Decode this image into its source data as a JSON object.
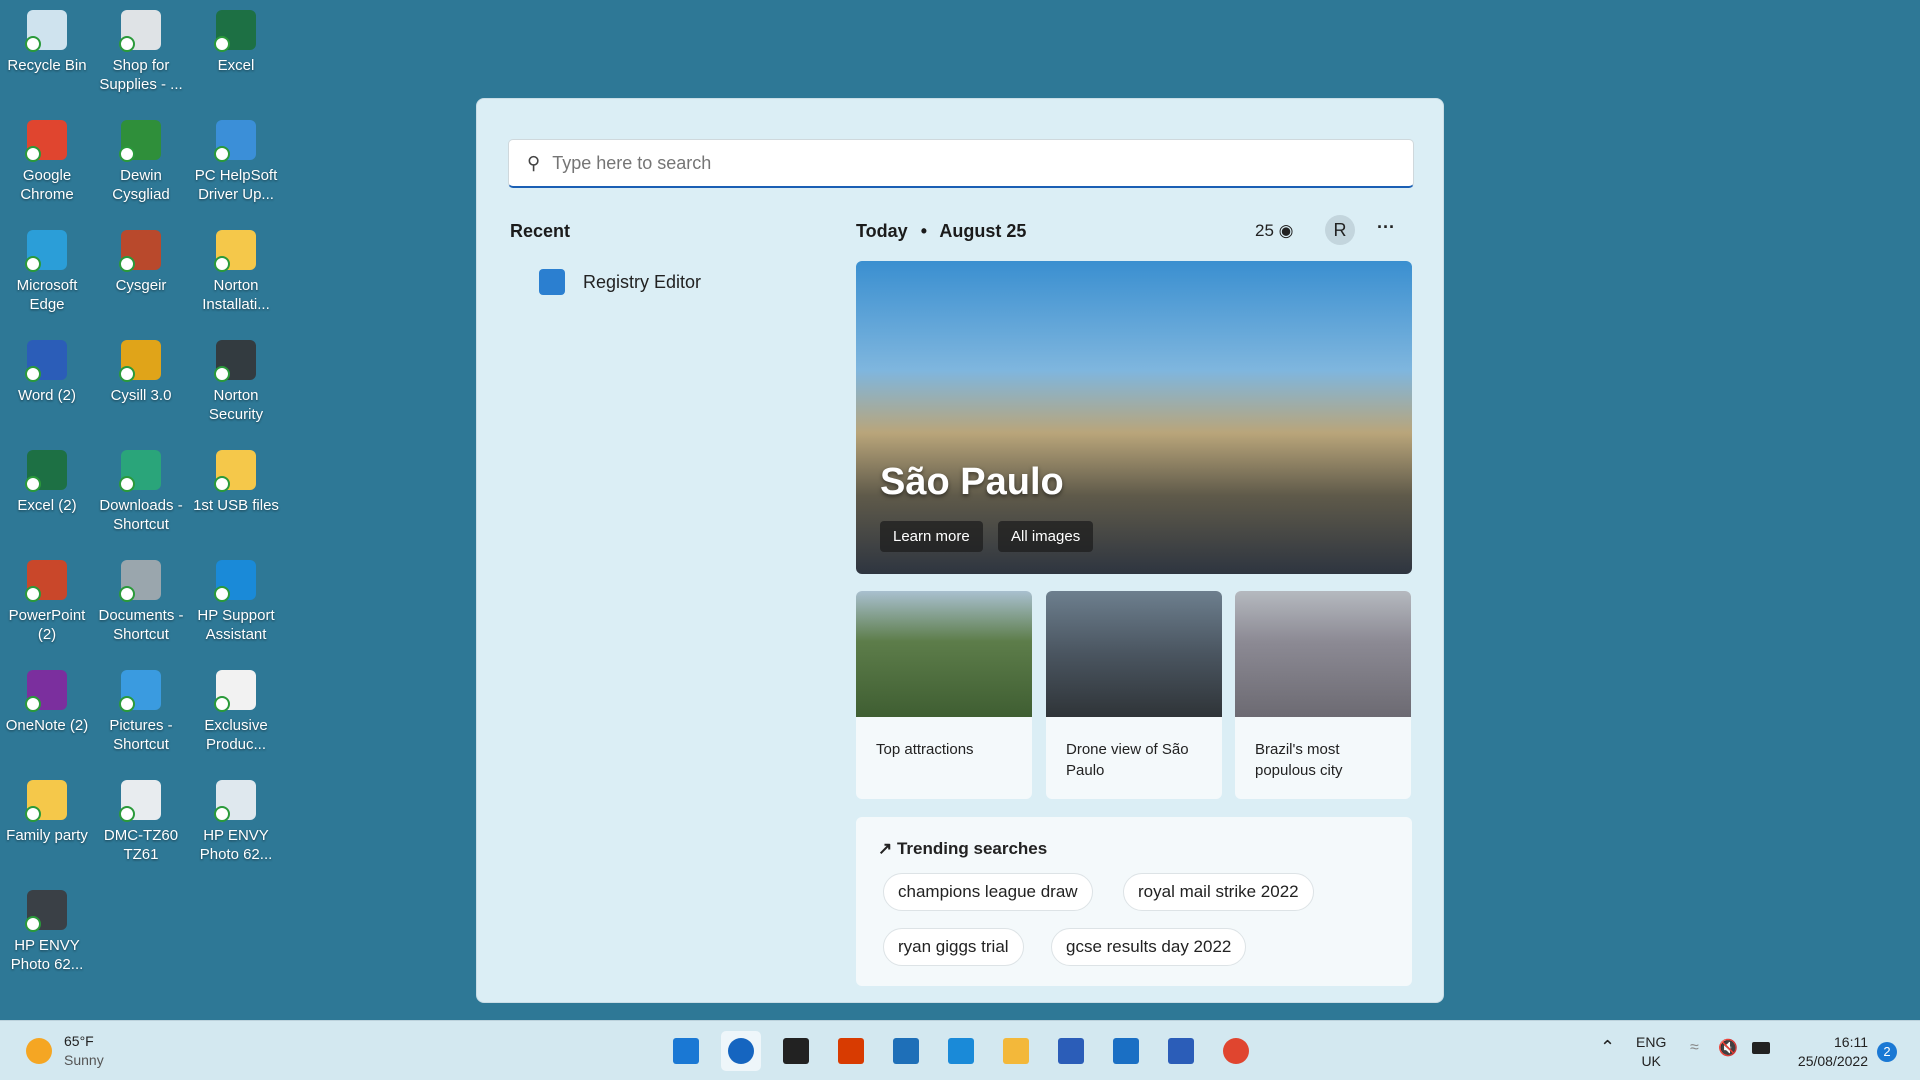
{
  "desktop": {
    "icons": [
      {
        "label": "Recycle Bin",
        "color": "#cfe3ee"
      },
      {
        "label": "Shop for Supplies - ...",
        "color": "#dfe3e6"
      },
      {
        "label": "Excel",
        "color": "#1d7044"
      },
      {
        "label": "Google Chrome",
        "color": "#e0452f"
      },
      {
        "label": "Dewin Cysgliad",
        "color": "#2f8f3a"
      },
      {
        "label": "PC HelpSoft Driver Up...",
        "color": "#3b8fd8"
      },
      {
        "label": "Microsoft Edge",
        "color": "#2b9ed8"
      },
      {
        "label": "Cysgeir",
        "color": "#b9492c"
      },
      {
        "label": "Norton Installati...",
        "color": "#f5c84a"
      },
      {
        "label": "Word (2)",
        "color": "#2b5db8"
      },
      {
        "label": "Cysill 3.0",
        "color": "#e0a419"
      },
      {
        "label": "Norton Security",
        "color": "#333b40"
      },
      {
        "label": "Excel (2)",
        "color": "#1d7044"
      },
      {
        "label": "Downloads - Shortcut",
        "color": "#2aa57a"
      },
      {
        "label": "1st USB files",
        "color": "#f5c84a"
      },
      {
        "label": "PowerPoint (2)",
        "color": "#c9472a"
      },
      {
        "label": "Documents - Shortcut",
        "color": "#9aa6ad"
      },
      {
        "label": "HP Support Assistant",
        "color": "#1a8ad8"
      },
      {
        "label": "OneNote (2)",
        "color": "#7b2f9e"
      },
      {
        "label": "Pictures - Shortcut",
        "color": "#3a9be0"
      },
      {
        "label": "Exclusive Produc...",
        "color": "#f2f2f2"
      },
      {
        "label": "Family party",
        "color": "#f5c84a"
      },
      {
        "label": "DMC-TZ60 TZ61",
        "color": "#e8ecef"
      },
      {
        "label": "HP ENVY Photo 62...",
        "color": "#dfe8ee"
      },
      {
        "label": "HP ENVY Photo 62...",
        "color": "#3a4046"
      }
    ]
  },
  "search": {
    "placeholder": "Type here to search"
  },
  "recent": {
    "title": "Recent",
    "items": [
      {
        "label": "Registry Editor"
      }
    ]
  },
  "today": {
    "label": "Today",
    "sep": "•",
    "date": "August 25",
    "points": "25",
    "avatar": "R",
    "more": "···"
  },
  "hero": {
    "title": "São Paulo",
    "learn_more": "Learn more",
    "all_images": "All images"
  },
  "tiles": [
    {
      "label": "Top attractions",
      "color": "#5d7d4a"
    },
    {
      "label": "Drone view of São Paulo",
      "color": "#4a5560"
    },
    {
      "label": "Brazil's most populous city",
      "color": "#8c8a94"
    }
  ],
  "trending": {
    "title": "Trending searches",
    "items": [
      "champions league draw",
      "royal mail strike 2022",
      "ryan giggs trial",
      "gcse results day 2022"
    ]
  },
  "taskbar": {
    "weather_temp": "65°F",
    "weather_desc": "Sunny",
    "lang1": "ENG",
    "lang2": "UK",
    "time": "16:11",
    "date": "25/08/2022",
    "notifications": "2",
    "apps": [
      {
        "name": "start",
        "color": "#1a78d4"
      },
      {
        "name": "search",
        "color": "#1565c0"
      },
      {
        "name": "task-view",
        "color": "#222"
      },
      {
        "name": "office",
        "color": "#d83b01"
      },
      {
        "name": "remote-desktop",
        "color": "#1e6fb8"
      },
      {
        "name": "l-app",
        "color": "#1a8ad8"
      },
      {
        "name": "file-explorer",
        "color": "#f3b83a"
      },
      {
        "name": "store",
        "color": "#2b5db8"
      },
      {
        "name": "mail",
        "color": "#1a6fc4"
      },
      {
        "name": "word",
        "color": "#2b5db8"
      },
      {
        "name": "chrome",
        "color": "#e0452f"
      }
    ]
  }
}
